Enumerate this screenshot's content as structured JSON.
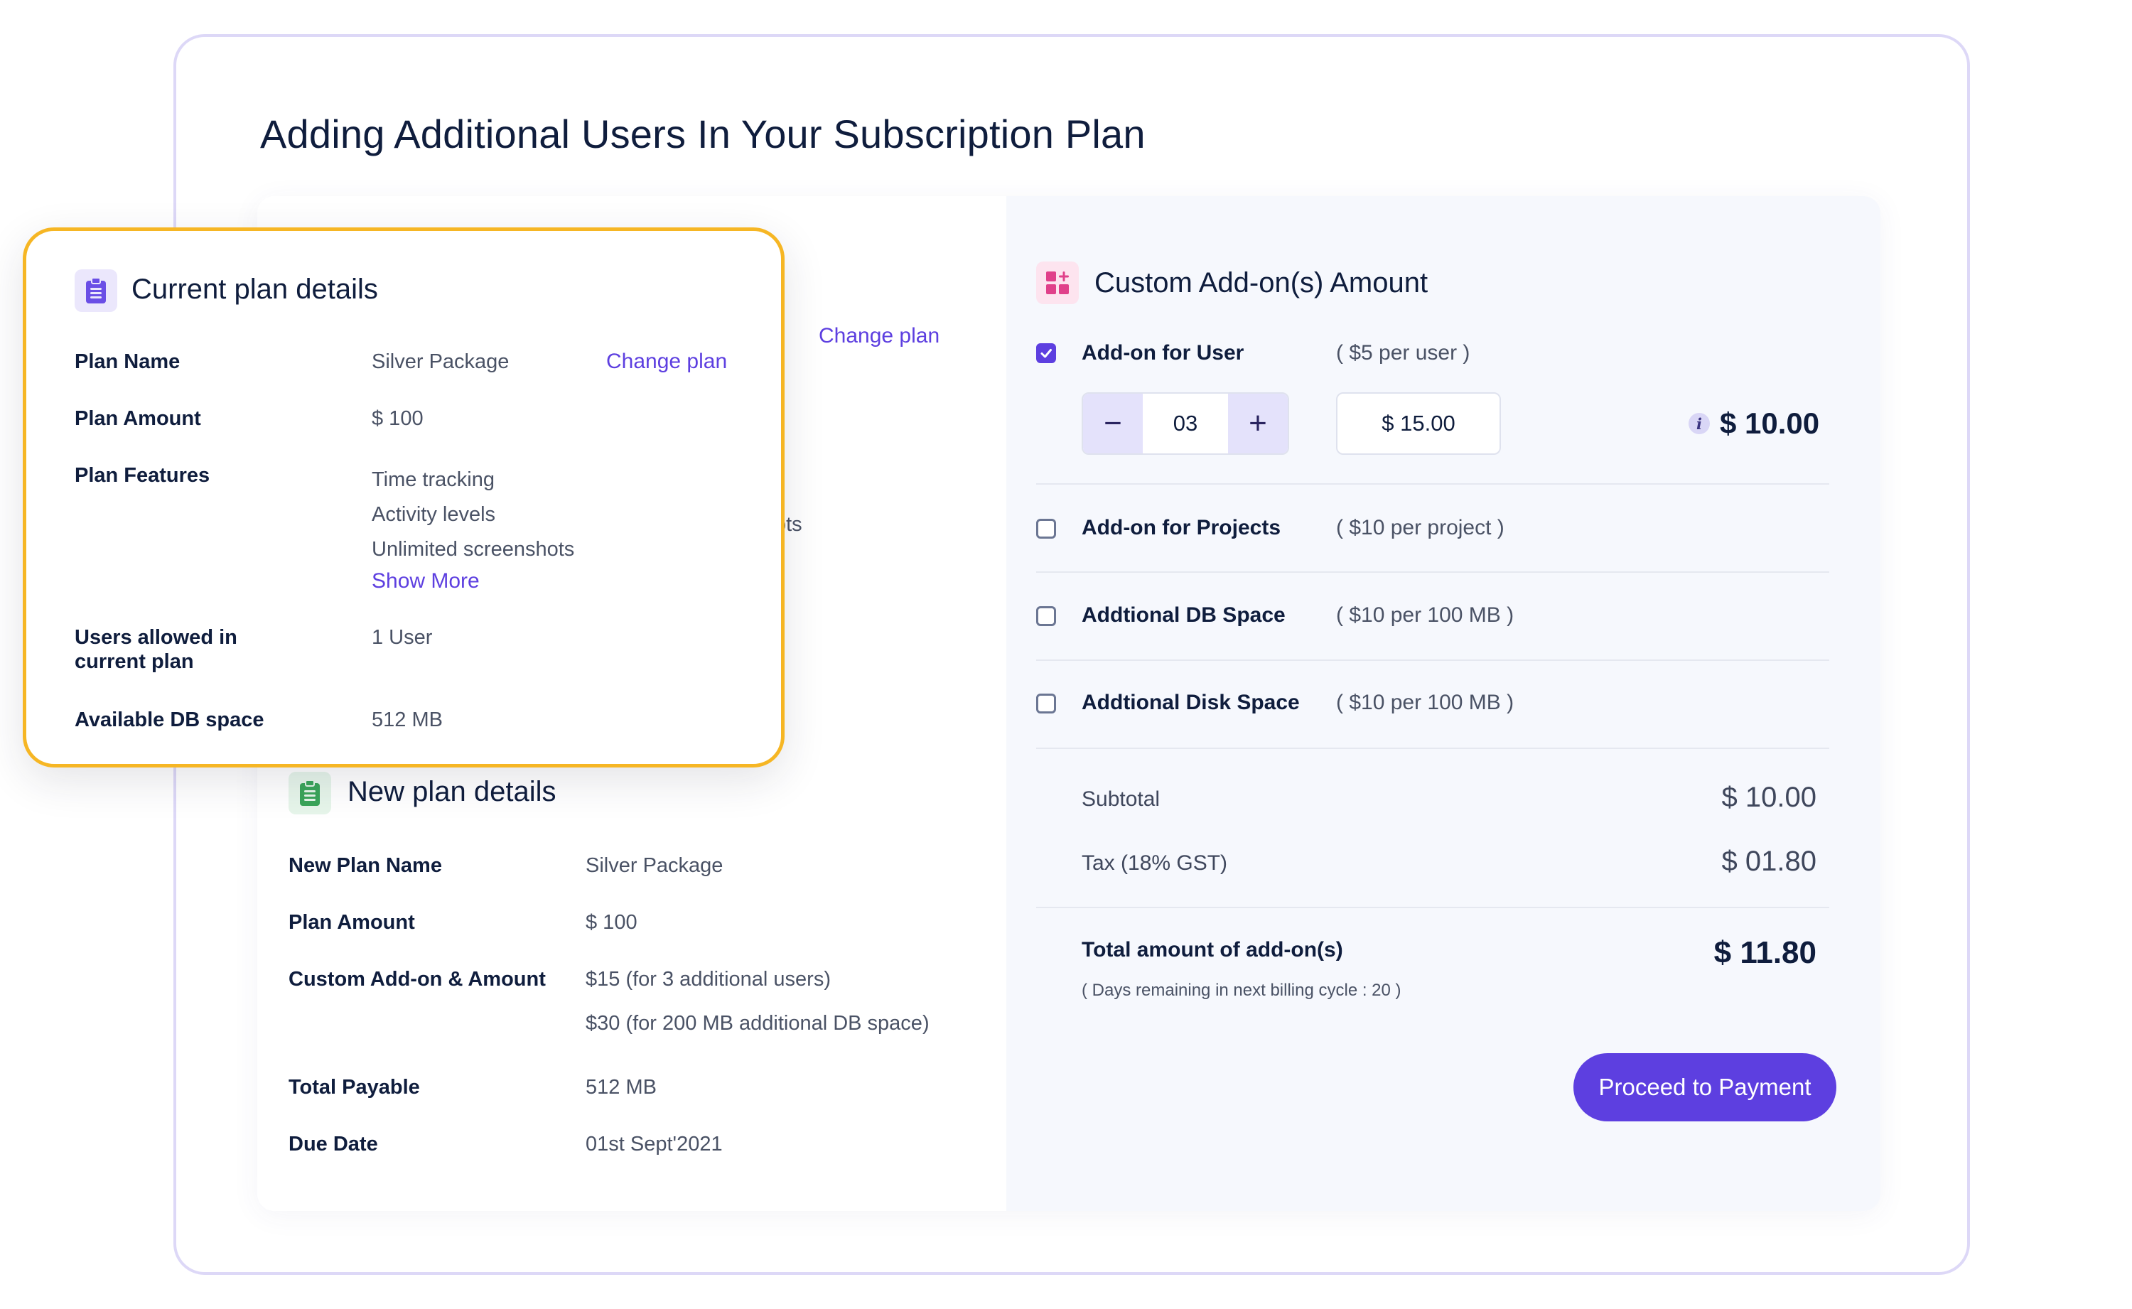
{
  "page": {
    "title": "Adding Additional Users In Your Subscription Plan"
  },
  "current_plan": {
    "title": "Current plan details",
    "change_plan_label": "Change plan",
    "plan_name_label": "Plan Name",
    "plan_name_value": "Silver Package",
    "plan_amount_label": "Plan Amount",
    "plan_amount_value": "$ 100",
    "features_label": "Plan Features",
    "features": [
      "Time tracking",
      "Activity levels",
      "Unlimited screenshots"
    ],
    "show_more_label": "Show More",
    "users_allowed_label_line1": "Users allowed in",
    "users_allowed_label_line2": "current plan",
    "users_allowed_value": "1 User",
    "db_space_label": "Available DB space",
    "db_space_value": "512 MB"
  },
  "background_card": {
    "change_plan_label": "Change plan",
    "clipped_text": "ots"
  },
  "new_plan": {
    "title": "New plan details",
    "rows": [
      {
        "label": "New Plan Name",
        "value": "Silver Package"
      },
      {
        "label": "Plan Amount",
        "value": "$ 100"
      },
      {
        "label": "Custom Add-on & Amount",
        "value": "$15 (for 3 additional users)",
        "value2": "$30 (for 200 MB additional DB space)"
      },
      {
        "label": "Total Payable",
        "value": "512 MB"
      },
      {
        "label": "Due Date",
        "value": "01st Sept'2021"
      }
    ]
  },
  "addons": {
    "title": "Custom Add-on(s) Amount",
    "items": [
      {
        "label": "Add-on for User",
        "rate": "( $5 per user )",
        "checked": true
      },
      {
        "label": "Add-on for Projects",
        "rate": "( $10 per project )",
        "checked": false
      },
      {
        "label": "Addtional DB Space",
        "rate": "( $10 per 100 MB )",
        "checked": false
      },
      {
        "label": "Addtional Disk Space",
        "rate": "( $10 per 100 MB )",
        "checked": false
      }
    ],
    "user_stepper": {
      "minus": "−",
      "value": "03",
      "plus": "+"
    },
    "user_amount_input": "$ 15.00",
    "user_line_total": "$ 10.00",
    "subtotal_label": "Subtotal",
    "subtotal_value": "$ 10.00",
    "tax_label": "Tax (18% GST)",
    "tax_value": "$ 01.80",
    "total_label": "Total amount of add-on(s)",
    "total_value": "$ 11.80",
    "days_note": "( Days remaining in next billing cycle : 20 )",
    "proceed_label": "Proceed to Payment"
  },
  "colors": {
    "accent": "#5d3fe0",
    "highlight_border": "#f6b624",
    "frame_border": "#ddd8f7",
    "green_icon": "#3aa55a",
    "pink_icon": "#e0408a"
  },
  "icons": {
    "current_plan": "clipboard-icon",
    "new_plan": "clipboard-icon",
    "addons": "grid-plus-icon",
    "info": "info-icon"
  }
}
